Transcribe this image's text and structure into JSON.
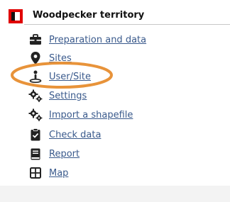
{
  "app": {
    "title": "Woodpecker territory",
    "brand_color": "#e00000",
    "link_color": "#3a5a8c",
    "highlight_color": "#e8933a"
  },
  "menu": {
    "items": [
      {
        "label": "Preparation and data",
        "icon": "toolbox-icon"
      },
      {
        "label": "Sites",
        "icon": "map-pin-icon"
      },
      {
        "label": "User/Site",
        "icon": "person-location-icon"
      },
      {
        "label": "Settings",
        "icon": "gears-icon"
      },
      {
        "label": "Import a shapefile",
        "icon": "gears-icon"
      },
      {
        "label": "Check data",
        "icon": "clipboard-check-icon"
      },
      {
        "label": "Report",
        "icon": "book-icon"
      },
      {
        "label": "Map",
        "icon": "grid-icon"
      }
    ]
  }
}
